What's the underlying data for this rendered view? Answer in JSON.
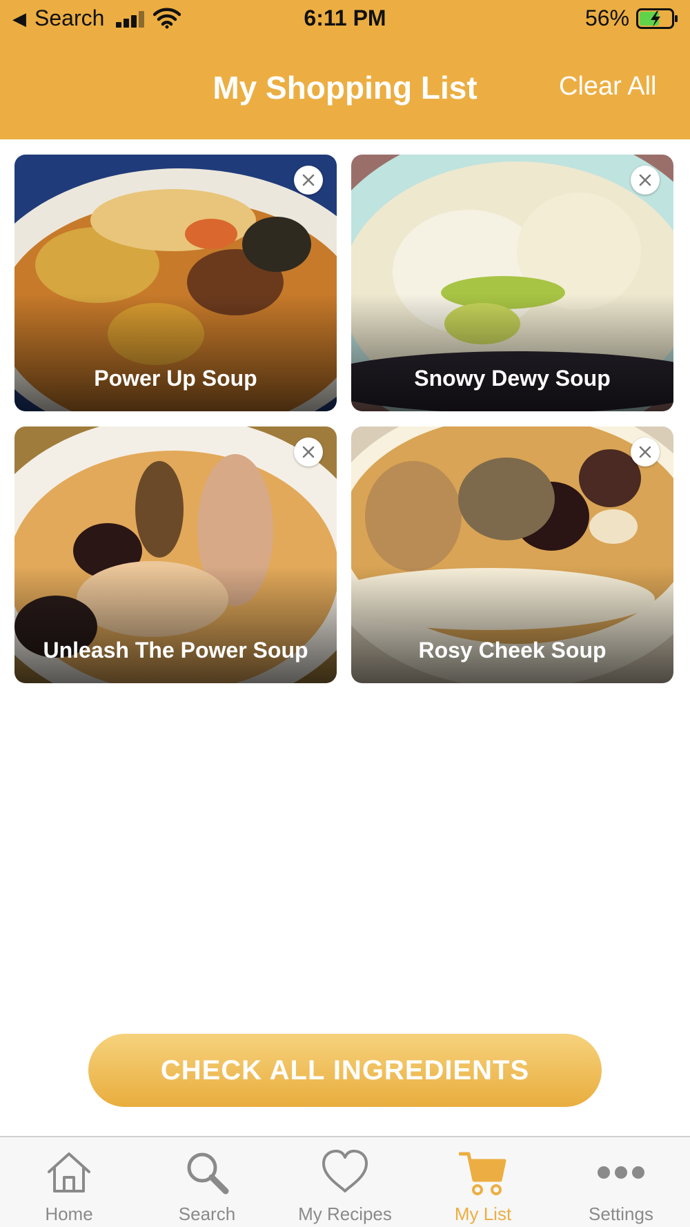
{
  "status_bar": {
    "back_label": "Search",
    "time": "6:11 PM",
    "battery": "56%"
  },
  "header": {
    "title": "My Shopping List",
    "clear_all": "Clear All"
  },
  "recipes": [
    {
      "title": "Power Up Soup"
    },
    {
      "title": "Snowy Dewy Soup"
    },
    {
      "title": "Unleash The Power Soup"
    },
    {
      "title": "Rosy Cheek Soup"
    }
  ],
  "cta_label": "CHECK ALL INGREDIENTS",
  "tabs": [
    {
      "label": "Home",
      "icon": "home-icon"
    },
    {
      "label": "Search",
      "icon": "search-icon"
    },
    {
      "label": "My Recipes",
      "icon": "heart-icon"
    },
    {
      "label": "My List",
      "icon": "cart-icon",
      "active": true
    },
    {
      "label": "Settings",
      "icon": "more-icon"
    }
  ],
  "colors": {
    "brand": "#ecae42",
    "tab_inactive": "#8a8a8a"
  }
}
